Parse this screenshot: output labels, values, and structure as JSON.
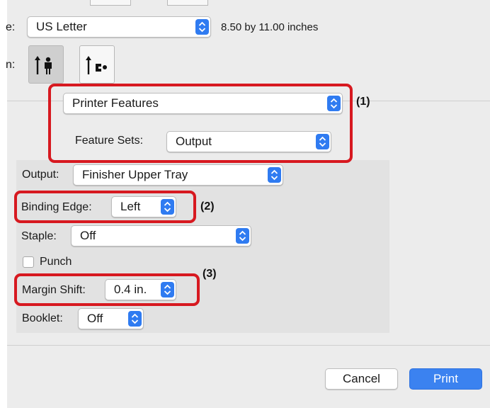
{
  "paper_size": {
    "label_fragment": "e:",
    "value": "US Letter",
    "dimensions": "8.50 by 11.00 inches"
  },
  "orientation": {
    "label_fragment": "n:",
    "portrait_icon": "portrait-orientation-icon",
    "landscape_icon": "landscape-orientation-icon"
  },
  "panel_selector": {
    "value": "Printer Features",
    "feature_sets_label": "Feature Sets:",
    "feature_sets_value": "Output"
  },
  "output": {
    "label": "Output:",
    "value": "Finisher Upper Tray"
  },
  "binding_edge": {
    "label": "Binding Edge:",
    "value": "Left"
  },
  "staple": {
    "label": "Staple:",
    "value": "Off"
  },
  "punch": {
    "label": "Punch",
    "checked": false
  },
  "margin_shift": {
    "label": "Margin Shift:",
    "value": "0.4 in."
  },
  "booklet": {
    "label": "Booklet:",
    "value": "Off"
  },
  "callouts": [
    "(1)",
    "(2)",
    "(3)"
  ],
  "buttons": {
    "cancel": "Cancel",
    "print": "Print"
  },
  "colors": {
    "accent": "#2f7bf1",
    "highlight": "#d71920",
    "background": "#ececec"
  }
}
